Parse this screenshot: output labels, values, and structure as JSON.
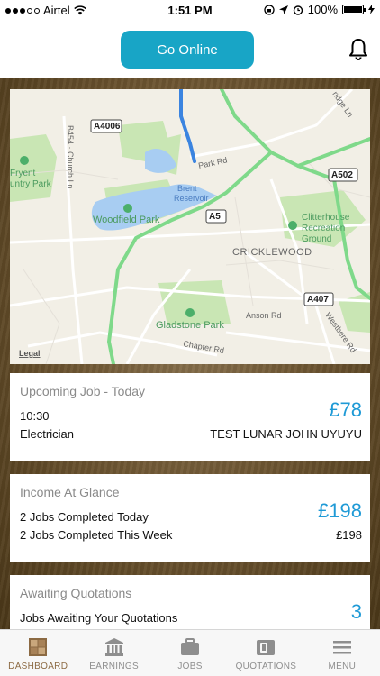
{
  "status_bar": {
    "carrier": "Airtel",
    "time": "1:51 PM",
    "battery": "100%"
  },
  "header": {
    "go_online_label": "Go Online",
    "bell_icon": "bell-icon"
  },
  "map": {
    "labels": {
      "a4006": "A4006",
      "park_rd": "Park Rd",
      "a502": "A502",
      "a5": "A5",
      "a407": "A407",
      "brent_reservoir": "Brent",
      "brent_reservoir_2": "Reservoir",
      "woodfield_park": "Woodfield Park",
      "clitterhouse_1": "Clitterhouse",
      "clitterhouse_2": "Recreation",
      "clitterhouse_3": "Ground",
      "cricklewood": "CRICKLEWOOD",
      "gladstone_park": "Gladstone Park",
      "anson_rd": "Anson Rd",
      "chapter_rd": "Chapter Rd",
      "westbere_rd": "Westbere Rd",
      "church_ln": "B454 · Church Ln",
      "fryent_1": "Fryent",
      "fryent_2": "untry Park",
      "bridge_ln": "ridge Ln",
      "legal": "Legal"
    }
  },
  "upcoming_job": {
    "title": "Upcoming Job - Today",
    "time": "10:30",
    "trade": "Electrician",
    "amount": "£78",
    "customer": "TEST LUNAR JOHN UYUYU"
  },
  "income": {
    "title": "Income At Glance",
    "line1": "2 Jobs Completed Today",
    "amount_today": "£198",
    "line2": "2 Jobs Completed This Week",
    "amount_week": "£198"
  },
  "quotations": {
    "title": "Awaiting Quotations",
    "line1": "Jobs Awaiting Your Quotations",
    "count": "3"
  },
  "tabs": [
    {
      "label": "DASHBOARD",
      "icon": "dashboard-icon",
      "active": true
    },
    {
      "label": "EARNINGS",
      "icon": "bank-icon",
      "active": false
    },
    {
      "label": "JOBS",
      "icon": "briefcase-icon",
      "active": false
    },
    {
      "label": "QUOTATIONS",
      "icon": "wallet-icon",
      "active": false
    },
    {
      "label": "MENU",
      "icon": "hamburger-icon",
      "active": false
    }
  ],
  "colors": {
    "accent": "#18a5c6",
    "amount": "#1f9ad6",
    "active_tab": "#8c6a43"
  }
}
